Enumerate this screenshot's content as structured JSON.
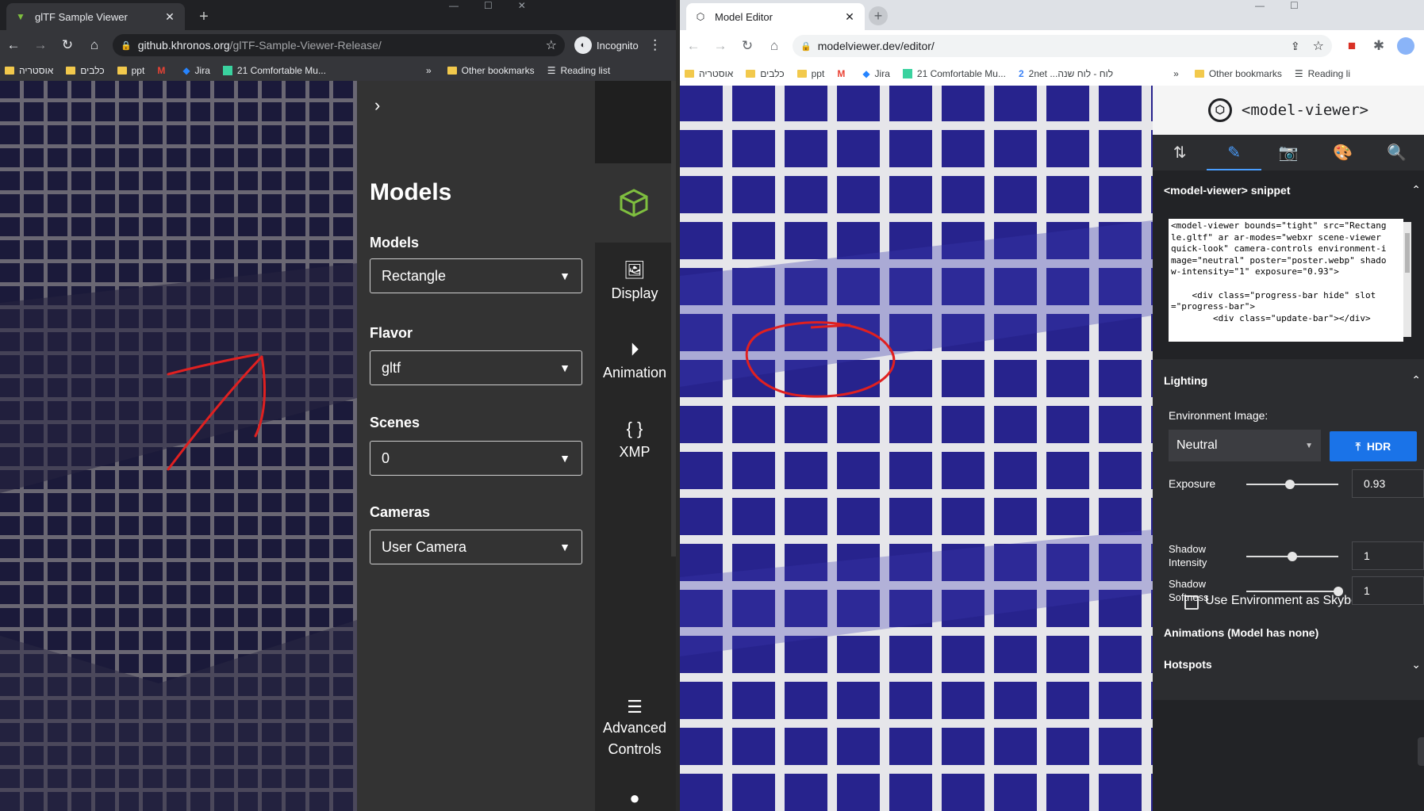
{
  "left": {
    "tab_title": "glTF Sample Viewer",
    "url_host": "github.khronos.org",
    "url_path": "/glTF-Sample-Viewer-Release/",
    "incognito_label": "Incognito",
    "bookmarks": [
      "אוסטריה",
      "כלבים",
      "ppt",
      "Jira",
      "21 Comfortable Mu..."
    ],
    "bookmarks_more": "»",
    "other_bookmarks": "Other bookmarks",
    "reading_list": "Reading list",
    "panel": {
      "title": "Models",
      "models_label": "Models",
      "models_value": "Rectangle",
      "flavor_label": "Flavor",
      "flavor_value": "gltf",
      "scenes_label": "Scenes",
      "scenes_value": "0",
      "cameras_label": "Cameras",
      "cameras_value": "User Camera"
    },
    "rail": {
      "display": "Display",
      "animation": "Animation",
      "xmp_icon": "{ }",
      "xmp": "XMP",
      "advanced_line1": "Advanced",
      "advanced_line2": "Controls"
    }
  },
  "right": {
    "tab_title": "Model Editor",
    "url": "modelviewer.dev/editor/",
    "bookmarks": [
      "אוסטריה",
      "כלבים",
      "ppt",
      "Jira",
      "21 Comfortable Mu...",
      "2net ...לוח - לוח שנה"
    ],
    "bookmarks_more": "»",
    "other_bookmarks": "Other bookmarks",
    "reading_list": "Reading li",
    "header_title": "<model-viewer>",
    "snippet_heading": "<model-viewer> snippet",
    "snippet_text": "<model-viewer bounds=\"tight\" src=\"Rectangle.gltf\" ar ar-modes=\"webxr scene-viewer quick-look\" camera-controls environment-image=\"neutral\" poster=\"poster.webp\" shadow-intensity=\"1\" exposure=\"0.93\">\n\n    <div class=\"progress-bar hide\" slot=\"progress-bar\">\n        <div class=\"update-bar\"></div>",
    "lighting_heading": "Lighting",
    "env_image_label": "Environment Image:",
    "env_value": "Neutral",
    "hdr_label": "HDR",
    "exposure_label": "Exposure",
    "exposure_value": "0.93",
    "exposure_slider": 0.47,
    "skybox_label": "Use Environment as Skybox",
    "shadow_intensity_line1": "Shadow",
    "shadow_intensity_line2": "Intensity",
    "shadow_intensity_value": "1",
    "shadow_intensity_slider": 0.5,
    "shadow_softness_line1": "Shadow",
    "shadow_softness_line2": "Softness",
    "shadow_softness_value": "1",
    "shadow_softness_slider": 1.0,
    "animations_heading": "Animations (Model has none)",
    "hotspots_heading": "Hotspots"
  },
  "colors": {
    "accent_green": "#7fbf3f",
    "accent_blue": "#1a73e8",
    "annotation_red": "#e02020"
  }
}
